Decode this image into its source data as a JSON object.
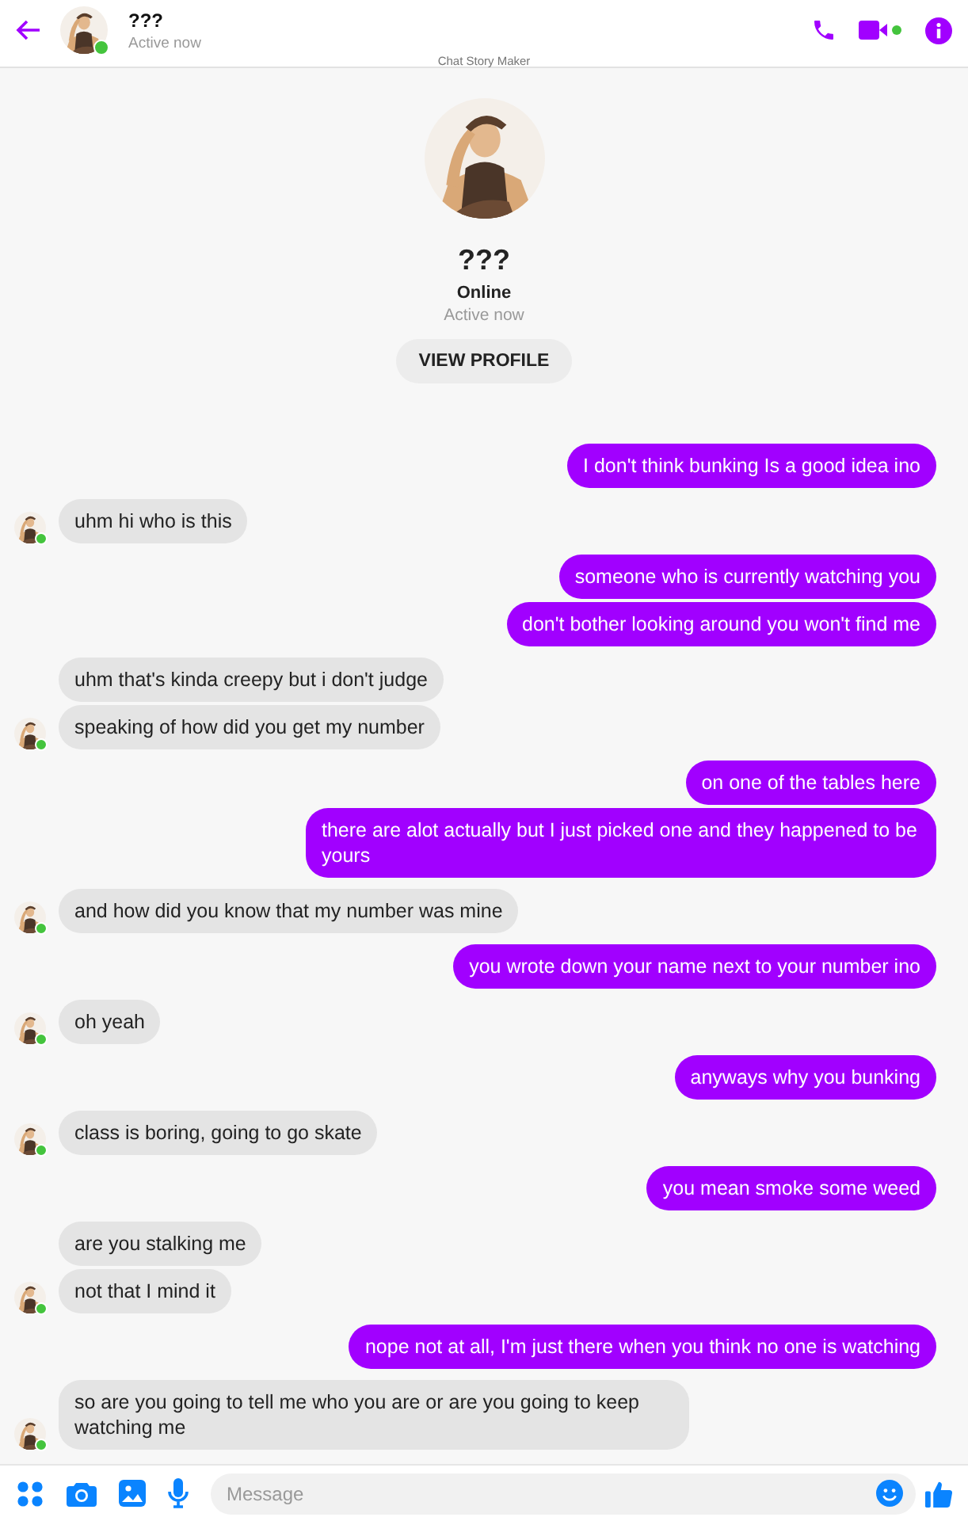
{
  "header": {
    "title": "???",
    "status": "Active now",
    "online": true,
    "caption": "Chat Story Maker"
  },
  "profile": {
    "name": "???",
    "presence": "Online",
    "status": "Active now",
    "button": "VIEW PROFILE"
  },
  "groups": [
    {
      "kind": "sent",
      "messages": [
        "I don't think bunking Is a good idea ino"
      ]
    },
    {
      "kind": "received",
      "messages": [
        "uhm hi who is this"
      ]
    },
    {
      "kind": "sent",
      "messages": [
        "someone who is currently watching you",
        "don't bother looking around you won't find me"
      ]
    },
    {
      "kind": "received",
      "messages": [
        "uhm that's kinda creepy but i don't judge",
        "speaking of how did you get my number"
      ]
    },
    {
      "kind": "sent",
      "messages": [
        "on one of the tables here",
        "there are alot actually but I just picked one and they happened to be yours"
      ]
    },
    {
      "kind": "received",
      "messages": [
        "and how did you know that my number was mine"
      ]
    },
    {
      "kind": "sent",
      "messages": [
        "you wrote down your name next to your number ino"
      ]
    },
    {
      "kind": "received",
      "messages": [
        "oh yeah"
      ]
    },
    {
      "kind": "sent",
      "messages": [
        "anyways why you bunking"
      ]
    },
    {
      "kind": "received",
      "messages": [
        "class is boring, going to go skate"
      ]
    },
    {
      "kind": "sent",
      "messages": [
        "you mean smoke some weed"
      ]
    },
    {
      "kind": "received",
      "messages": [
        "are you stalking me",
        "not that I mind it"
      ]
    },
    {
      "kind": "sent",
      "messages": [
        "nope not at all, I'm just there when you think no one is watching"
      ]
    },
    {
      "kind": "received",
      "messages": [
        "so are you going to tell me who you are or are you going to keep watching me"
      ]
    }
  ],
  "composer": {
    "placeholder": "Message"
  }
}
